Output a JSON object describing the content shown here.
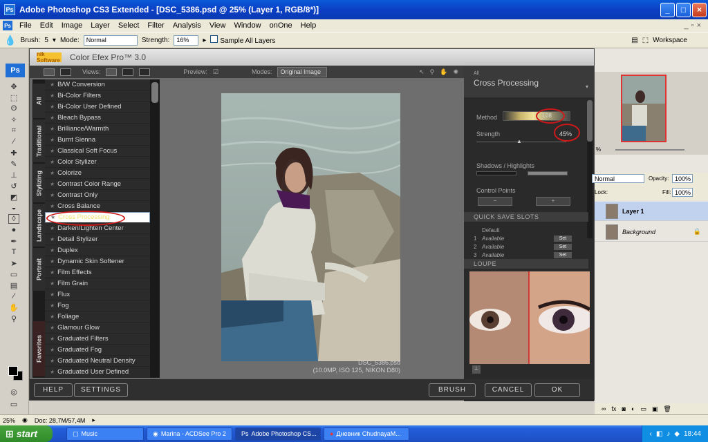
{
  "window": {
    "title": "Adobe Photoshop CS3 Extended - [DSC_5386.psd @ 25% (Layer 1, RGB/8*)]",
    "app_icon": "Ps"
  },
  "menu": [
    "File",
    "Edit",
    "Image",
    "Layer",
    "Select",
    "Filter",
    "Analysis",
    "View",
    "Window",
    "onOne",
    "Help"
  ],
  "options": {
    "brush_label": "Brush:",
    "brush_size": "5",
    "mode_label": "Mode:",
    "mode_value": "Normal",
    "strength_label": "Strength:",
    "strength_value": "16%",
    "sample_label": "Sample All Layers",
    "workspace": "Workspace"
  },
  "toolbox": {
    "badge": "Ps"
  },
  "cef": {
    "logo": "nik Software",
    "title": "Color Efex Pro™ 3.0",
    "views_label": "Views:",
    "preview_label": "Preview:",
    "modes_label": "Modes:",
    "modes_value": "Original Image",
    "tabs": [
      "All",
      "Traditional",
      "Stylizing",
      "Landscape",
      "Portrait",
      "Favorites"
    ],
    "filters": [
      "B/W Conversion",
      "Bi-Color Filters",
      "Bi-Color User Defined",
      "Bleach Bypass",
      "Brilliance/Warmth",
      "Burnt Sienna",
      "Classical Soft Focus",
      "Color Stylizer",
      "Colorize",
      "Contrast Color Range",
      "Contrast Only",
      "Cross Balance",
      "Cross Processing",
      "Darken/Lighten Center",
      "Detail Stylizer",
      "Duplex",
      "Dynamic Skin Softener",
      "Film Effects",
      "Film Grain",
      "Flux",
      "Fog",
      "Foliage",
      "Glamour Glow",
      "Graduated Filters",
      "Graduated Fog",
      "Graduated Neutral Density",
      "Graduated User Defined"
    ],
    "selected_filter": "Cross Processing",
    "file_name": "DSC_5386.psd",
    "file_info": "(10.0MP, ISO 125, NIKON D80)",
    "panel": {
      "category": "All",
      "name": "Cross Processing",
      "method_label": "Method",
      "method_value": "L08",
      "strength_label": "Strength",
      "strength_value": "45%",
      "shadows_label": "Shadows / Highlights",
      "control_label": "Control Points",
      "quick_save": "QUICK SAVE SLOTS",
      "default_label": "Default",
      "slots": [
        {
          "num": "1",
          "text": "Available",
          "btn": "Set"
        },
        {
          "num": "2",
          "text": "Available",
          "btn": "Set"
        },
        {
          "num": "3",
          "text": "Available",
          "btn": "Set"
        }
      ],
      "loupe": "LOUPE"
    },
    "buttons": {
      "help": "HELP",
      "settings": "SETTINGS",
      "brush": "BRUSH",
      "cancel": "CANCEL",
      "ok": "OK"
    }
  },
  "layers": {
    "mode": "Normal",
    "opacity_label": "Opacity:",
    "opacity": "100%",
    "lock_label": "Lock:",
    "fill_label": "Fill:",
    "fill": "100%",
    "items": [
      "Layer 1",
      "Background"
    ]
  },
  "nav_zoom": "%",
  "status": {
    "zoom": "25%",
    "doc": "Doc: 28,7M/57,4M"
  },
  "taskbar": {
    "start": "start",
    "tasks": [
      "Music",
      "Marina - ACDSee Pro 2",
      "Adobe Photoshop CS...",
      "Дневник ChudnayaM..."
    ],
    "time": "18:44"
  }
}
